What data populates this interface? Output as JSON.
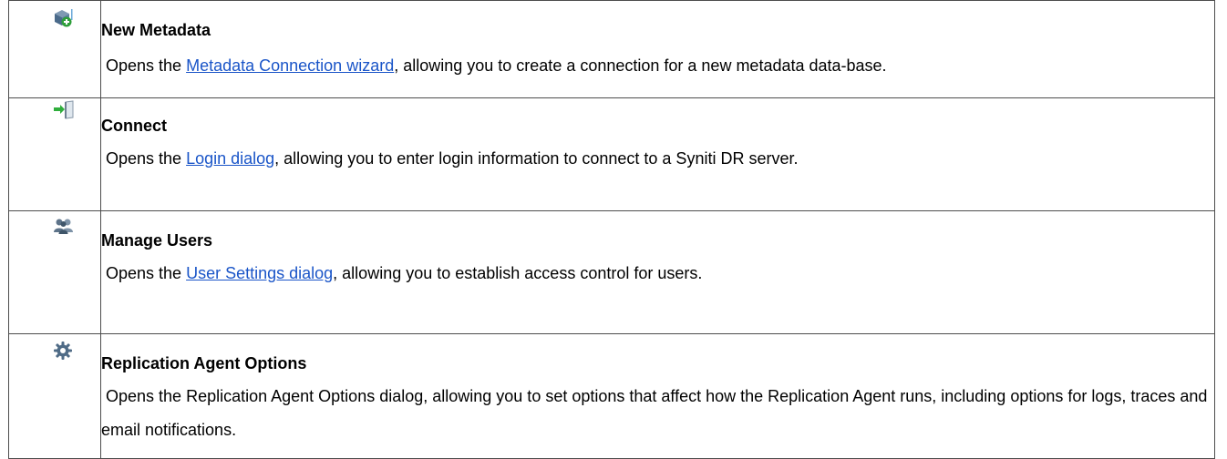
{
  "rows": [
    {
      "icon": "database-add-icon",
      "title": "New Metadata",
      "desc_pre": "Opens the ",
      "link": "Metadata Connection wizard",
      "desc_post": ", allowing you to create a connection for a new metadata data-base."
    },
    {
      "icon": "connect-door-icon",
      "title": "Connect",
      "desc_pre": "Opens the ",
      "link": "Login dialog",
      "desc_post": ", allowing you to enter login information to connect to a Syniti DR server."
    },
    {
      "icon": "users-icon",
      "title": "Manage Users",
      "desc_pre": "Opens the ",
      "link": "User Settings dialog",
      "desc_post": ", allowing you to establish access control for users."
    },
    {
      "icon": "gear-icon",
      "title": "Replication Agent Options",
      "desc": "Opens the Replication Agent Options dialog, allowing you to set options that affect how the Replication Agent runs, including options for logs, traces and email notifications."
    }
  ],
  "colors": {
    "link": "#1a55c8",
    "border": "#4d4d4d"
  }
}
